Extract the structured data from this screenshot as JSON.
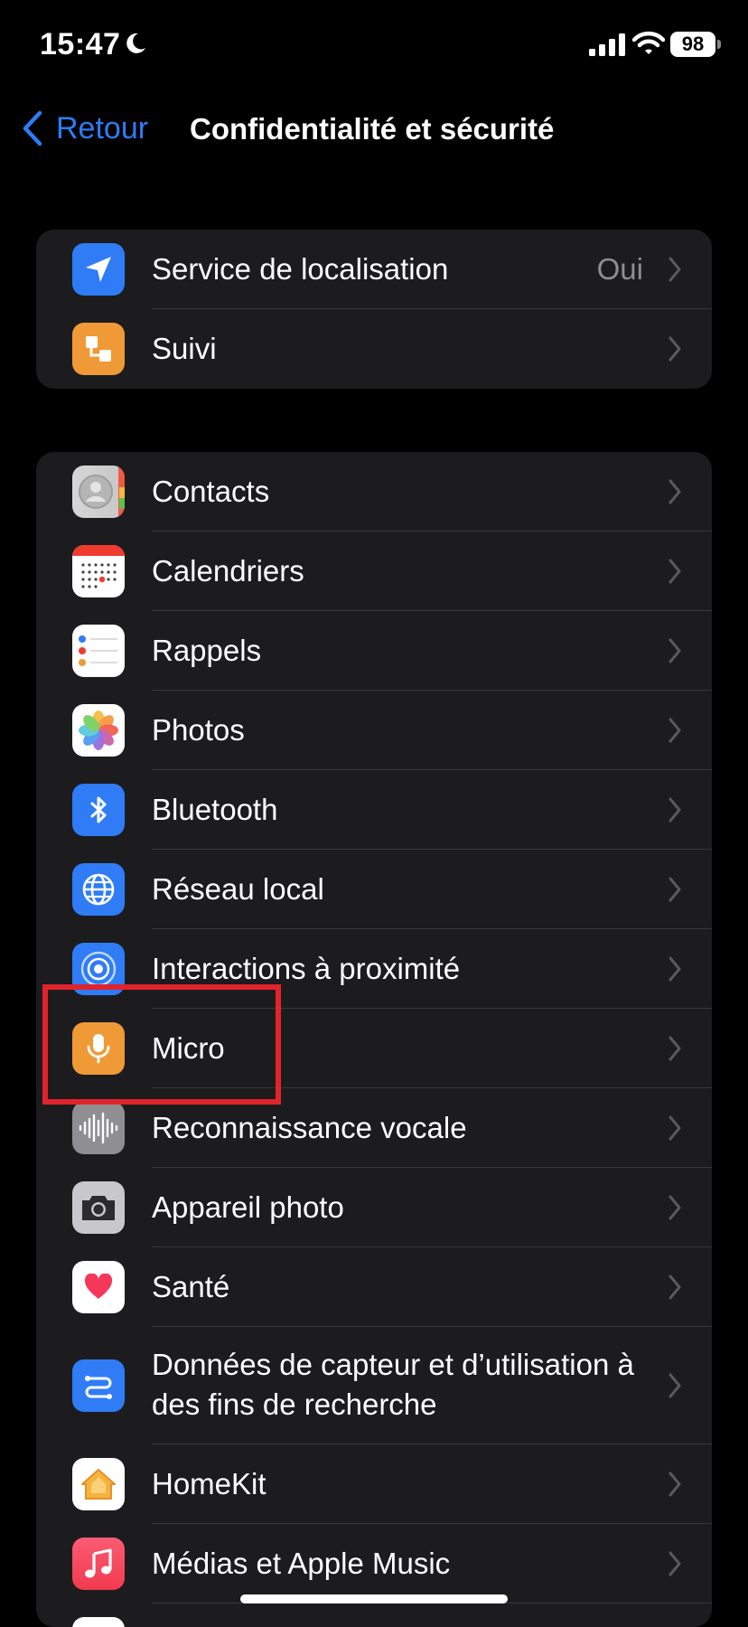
{
  "status": {
    "time": "15:47",
    "battery": "98"
  },
  "nav": {
    "back_label": "Retour",
    "title": "Confidentialité et sécurité"
  },
  "group1": [
    {
      "label": "Service de localisation",
      "value": "Oui",
      "icon": "location-arrow-icon"
    },
    {
      "label": "Suivi",
      "icon": "tracking-icon"
    }
  ],
  "group2": [
    {
      "label": "Contacts",
      "icon": "contacts-icon"
    },
    {
      "label": "Calendriers",
      "icon": "calendar-icon"
    },
    {
      "label": "Rappels",
      "icon": "reminders-icon"
    },
    {
      "label": "Photos",
      "icon": "photos-icon"
    },
    {
      "label": "Bluetooth",
      "icon": "bluetooth-icon"
    },
    {
      "label": "Réseau local",
      "icon": "globe-icon"
    },
    {
      "label": "Interactions à proximité",
      "icon": "nearby-interactions-icon"
    },
    {
      "label": "Micro",
      "icon": "microphone-icon"
    },
    {
      "label": "Reconnaissance vocale",
      "icon": "waveform-icon"
    },
    {
      "label": "Appareil photo",
      "icon": "camera-icon"
    },
    {
      "label": "Santé",
      "icon": "heart-icon"
    },
    {
      "label": "Données de capteur et d’utilisation à des fins de recherche",
      "icon": "research-sensor-icon"
    },
    {
      "label": "HomeKit",
      "icon": "home-icon"
    },
    {
      "label": "Médias et Apple Music",
      "icon": "music-note-icon"
    }
  ],
  "colors": {
    "accent": "#2f7cf6",
    "background": "#000000",
    "cell": "#1c1c1e",
    "separator": "#38383a",
    "highlight": "#e1232b"
  }
}
